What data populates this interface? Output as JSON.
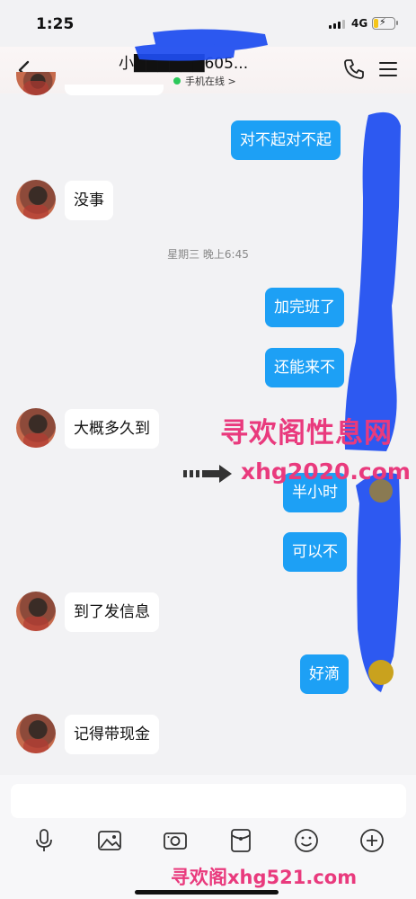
{
  "status_bar": {
    "time": "1:25",
    "network": "4G"
  },
  "header": {
    "title": "小██████605...",
    "online_status": "手机在线 >"
  },
  "timestamp": "星期三 晚上6:45",
  "messages": [
    {
      "side": "out",
      "text": "对不起对不起"
    },
    {
      "side": "in",
      "text": "没事"
    },
    {
      "side": "out",
      "text": "加完班了"
    },
    {
      "side": "out",
      "text": "还能来不"
    },
    {
      "side": "in",
      "text": "大概多久到"
    },
    {
      "side": "out",
      "text": "半小时"
    },
    {
      "side": "out",
      "text": "可以不"
    },
    {
      "side": "in",
      "text": "到了发信息"
    },
    {
      "side": "out",
      "text": "好滴"
    },
    {
      "side": "in",
      "text": "记得带现金"
    }
  ],
  "watermarks": {
    "line1": "寻欢阁性息网",
    "line2": "xhg2020.com",
    "line3": "寻欢阁xhg521.com"
  },
  "input": {
    "value": ""
  },
  "toolbar_icons": [
    "microphone-icon",
    "image-icon",
    "camera-icon",
    "red-packet-icon",
    "emoji-icon",
    "plus-icon"
  ],
  "colors": {
    "outgoing_bubble": "#1da0f5",
    "incoming_bubble": "#ffffff",
    "online_dot": "#2bc85a",
    "watermark": "#e93a7d",
    "scribble": "#1e4df0"
  }
}
